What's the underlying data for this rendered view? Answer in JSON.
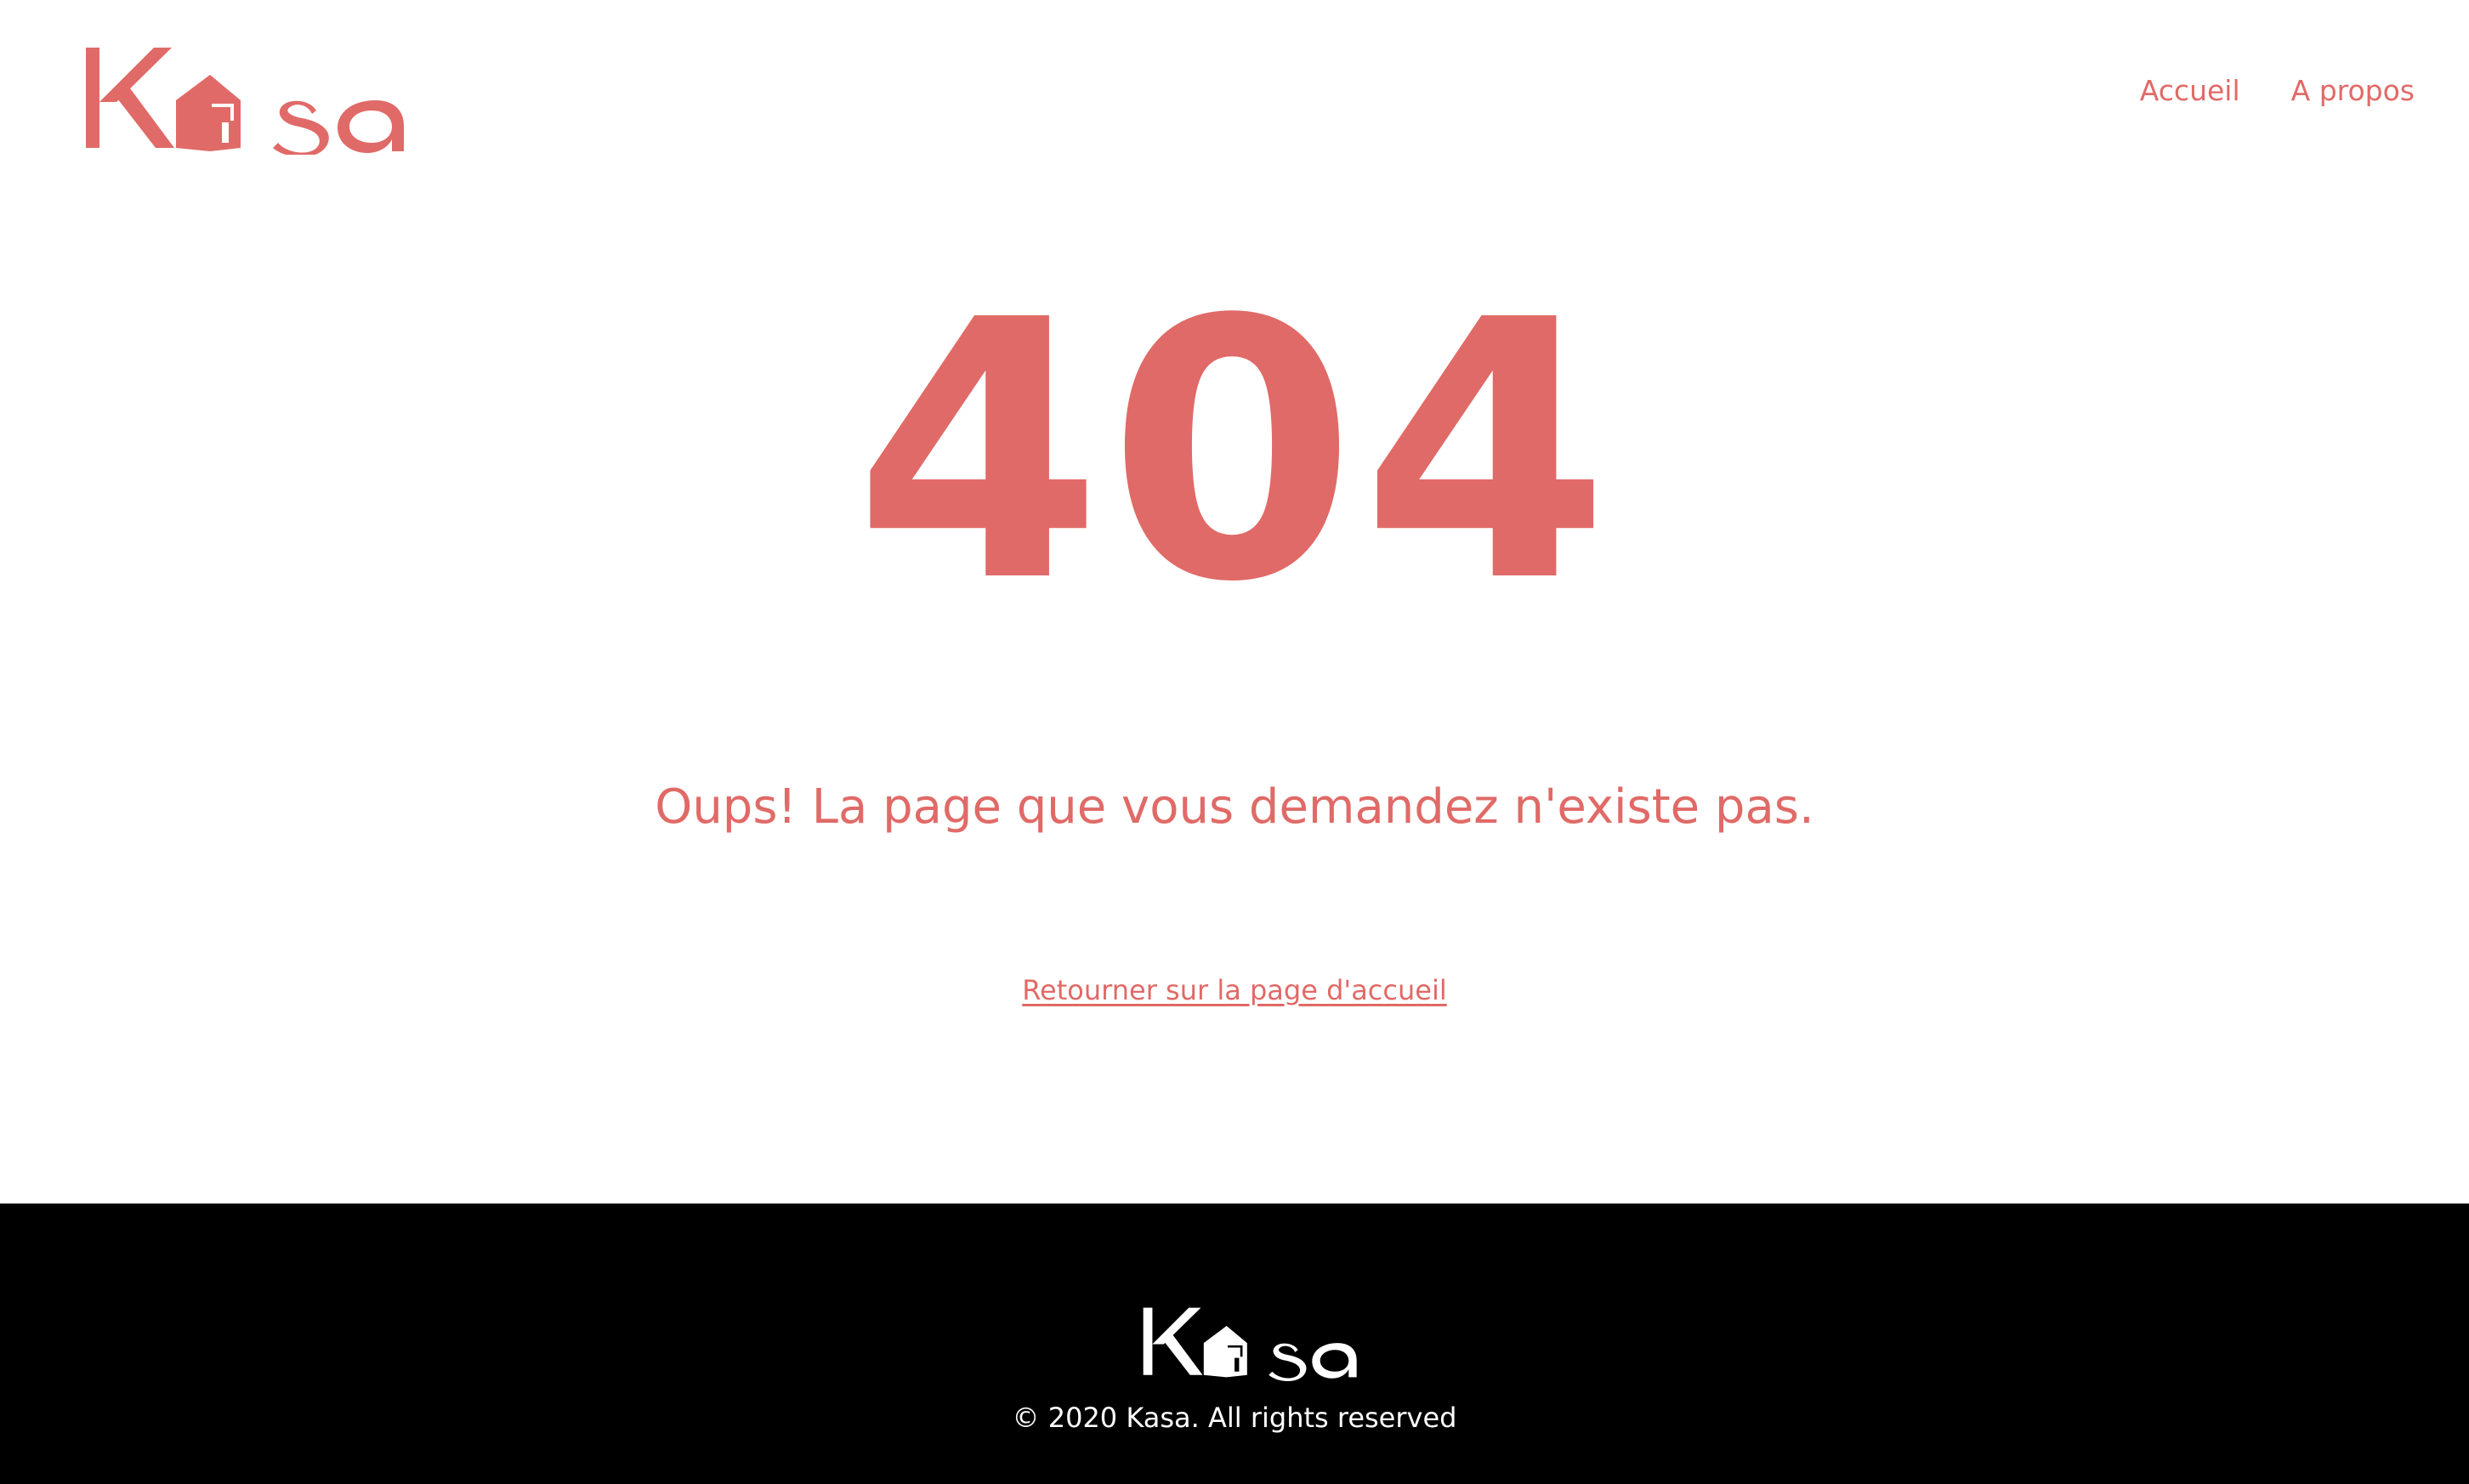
{
  "brand": {
    "name": "Kasa",
    "color": "#E06A67"
  },
  "header": {
    "nav": [
      {
        "label": "Accueil"
      },
      {
        "label": "A propos"
      }
    ]
  },
  "error": {
    "code": "404",
    "message": "Oups! La page que vous demandez n'existe pas.",
    "back_link": "Retourner sur la page d'accueil"
  },
  "footer": {
    "copyright": "© 2020 Kasa. All rights reserved",
    "background": "#000000",
    "text_color": "#FFFFFF"
  }
}
